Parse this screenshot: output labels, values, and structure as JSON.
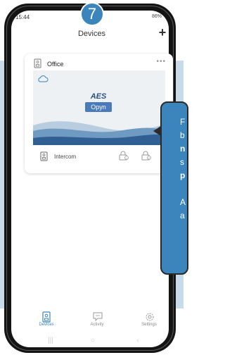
{
  "step_badge": "7",
  "status": {
    "time": "15:44",
    "right": "86%"
  },
  "app": {
    "title": "Devices",
    "add_label": "+"
  },
  "device_card": {
    "name": "Office",
    "more_label": "•••",
    "logo_top": "AES",
    "logo_bottom": "Opyn",
    "intercom_label": "Intercom"
  },
  "callout": {
    "lines": [
      "F",
      "b",
      "n",
      "s",
      "p",
      "",
      "A",
      "a"
    ]
  },
  "nav": {
    "devices": "Devices",
    "activity": "Activity",
    "settings": "Settings",
    "active": "devices"
  },
  "colors": {
    "accent": "#3b84bc",
    "band": "#c7dce8"
  }
}
